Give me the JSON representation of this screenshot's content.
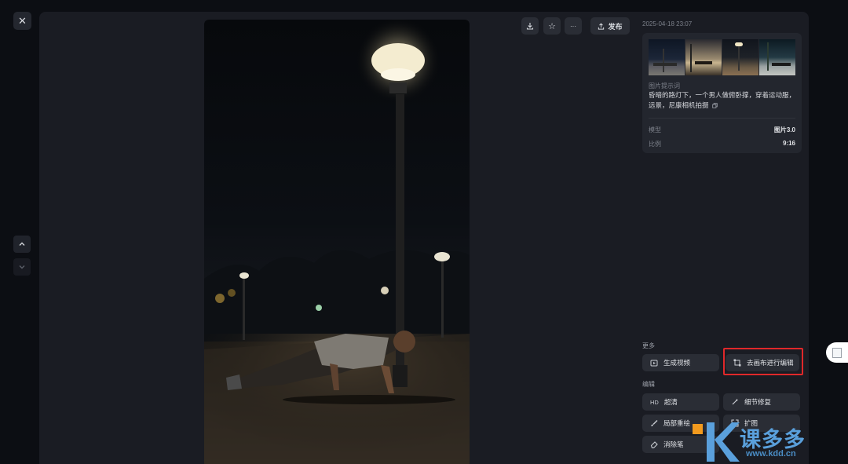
{
  "window": {
    "close_icon": "✕",
    "nav_up_icon": "chevron-up",
    "nav_down_icon": "chevron-down"
  },
  "toolbar": {
    "download_icon": "download",
    "favorite_icon": "☆",
    "more_icon": "···",
    "publish_icon": "upload",
    "publish_label": "发布"
  },
  "info": {
    "date": "2025-04-18 23:07",
    "prompt_label": "图片提示词",
    "prompt_text": "昏暗的路灯下，一个男人做俯卧撑，穿着运动服，远景，尼康相机拍摄",
    "copy_icon": "copy",
    "model_key": "模型",
    "model_value": "图片3.0",
    "ratio_key": "比例",
    "ratio_value": "9:16"
  },
  "more": {
    "label": "更多",
    "generate_video": "生成视频",
    "canvas_edit": "去画布进行编辑"
  },
  "edit": {
    "label": "编辑",
    "hd_icon": "HD",
    "hd": "超清",
    "detail_repair": "细节修复",
    "inpaint": "局部重绘",
    "expand": "扩图",
    "eraser": "消除笔"
  },
  "watermark": {
    "brand": "课多多",
    "url": "www.kdd.cn"
  },
  "colors": {
    "accent_red": "#e0282a",
    "panel_bg": "#1a1c23",
    "card_bg": "#23262e",
    "button_bg": "#2a2d35"
  }
}
